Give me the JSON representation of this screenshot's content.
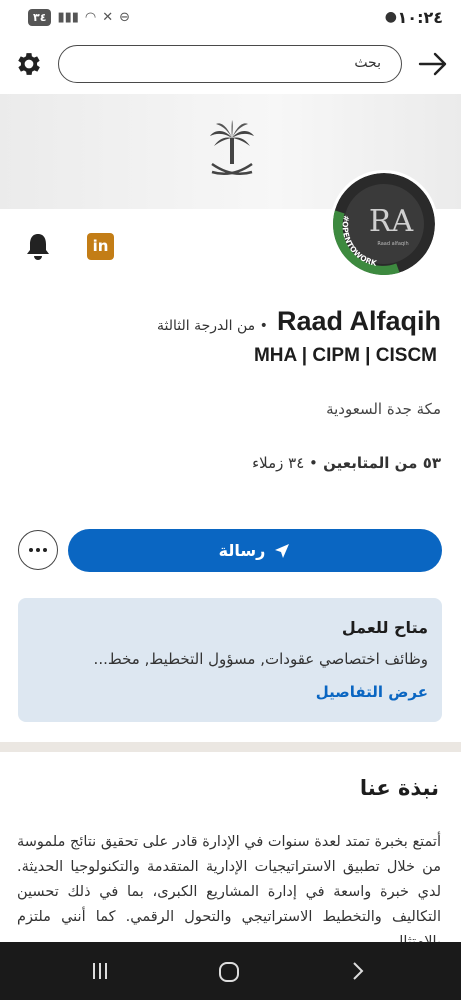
{
  "status_bar": {
    "time": "١٠:٢٤",
    "battery": "٣٤"
  },
  "search": {
    "placeholder": "بحث"
  },
  "avatar": {
    "initials": "RA",
    "caption": "Raad alfaqih",
    "frame_text": "#OPENTOWORK"
  },
  "profile": {
    "name": "Raad Alfaqih",
    "degree": "• من الدرجة الثالثة",
    "headline": "MHA | CIPM | CISCM",
    "location": "مكة جدة السعودية",
    "followers": "٥٣ من المتابعين",
    "connections": "• ٣٤ زملاء"
  },
  "actions": {
    "message_label": "رسالة"
  },
  "open_to_work": {
    "title": "متاح للعمل",
    "roles": "وظائف اختصاصي عقودات, مسؤول التخطيط, مخط...",
    "link": "عرض التفاصيل"
  },
  "about": {
    "title": "نبذة عنا",
    "text": "أتمتع بخبرة تمتد لعدة سنوات في الإدارة قادر على تحقيق نتائج ملموسة من خلال تطبيق الاستراتيجيات الإدارية المتقدمة والتكنولوجيا الحديثة. لدي خبرة واسعة في إدارة المشاريع الكبرى، بما في ذلك تحسين التكاليف والتخطيط الاستراتيجي والتحول الرقمي. كما أنني ملتزم بالامتثال"
  },
  "colors": {
    "accent": "#0a66c2",
    "open_to_work_bg": "#dde7f1",
    "linkedin_icon": "#c37d16",
    "otw_frame": "#3d8a3f"
  }
}
